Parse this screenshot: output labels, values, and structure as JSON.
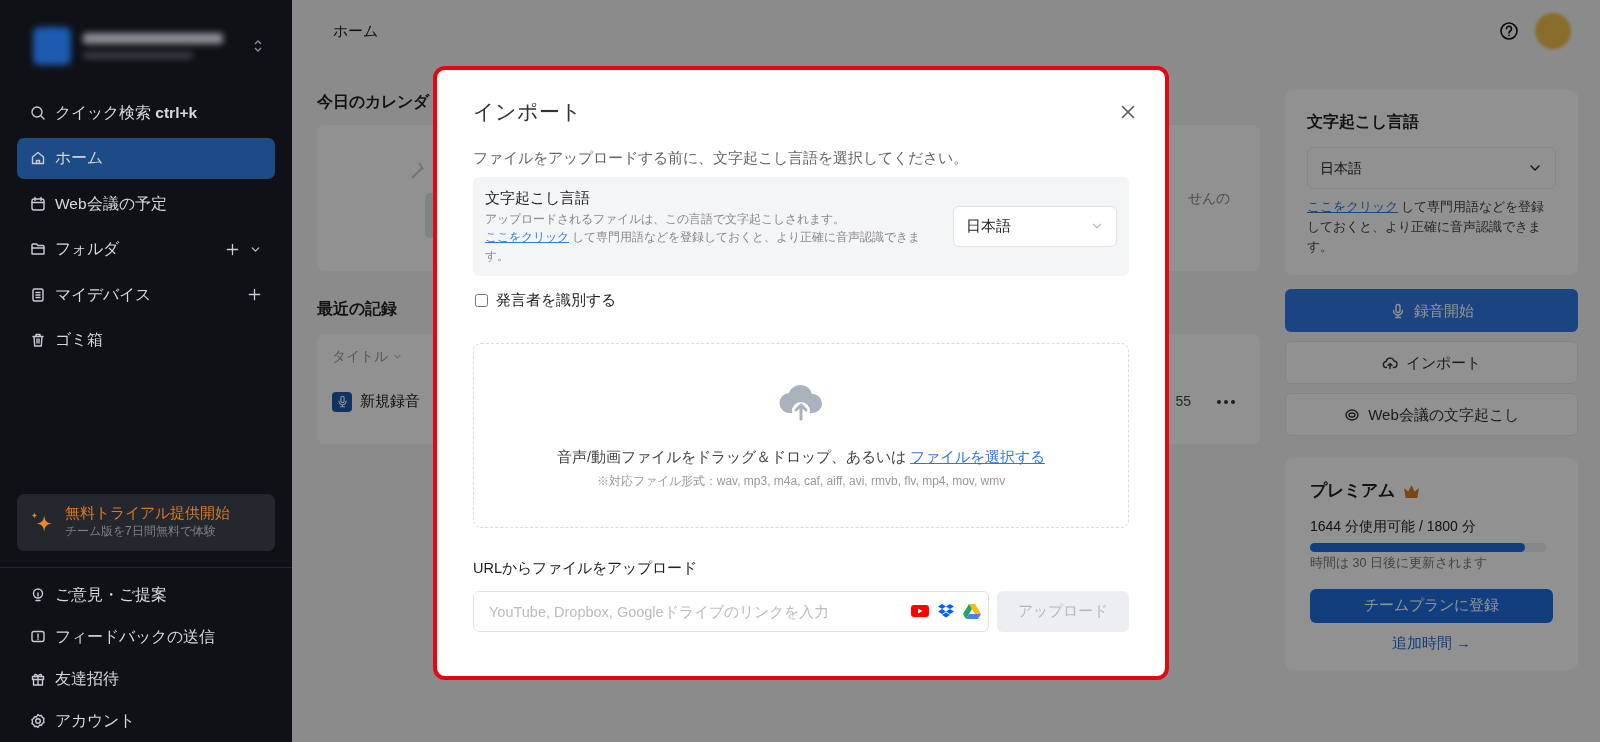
{
  "sidebar": {
    "items": [
      {
        "label": "クイック検索 **ctrl+k**",
        "selected": false
      },
      {
        "label": "ホーム",
        "selected": true
      },
      {
        "label": "Web会議の予定",
        "selected": false
      },
      {
        "label": "フォルダ",
        "selected": false,
        "add": true,
        "expand": true
      },
      {
        "label": "マイデバイス",
        "selected": false,
        "add": true
      },
      {
        "label": "ゴミ箱",
        "selected": false
      }
    ],
    "promo": {
      "title": "無料トライアル提供開始",
      "subtitle": "チーム版を7日間無料で体験"
    },
    "footer_items": [
      {
        "label": "ご意見・ご提案"
      },
      {
        "label": "フィードバックの送信"
      },
      {
        "label": "友達招待"
      },
      {
        "label": "アカウント"
      }
    ]
  },
  "header": {
    "title": "ホーム"
  },
  "calendar": {
    "title": "今日のカレンダ",
    "note": "せんの"
  },
  "recent": {
    "title": "最近の記録",
    "column": "タイトル",
    "rows": [
      {
        "title": "新規録音",
        "time": "55"
      }
    ]
  },
  "right_panel": {
    "language_title": "文字起こし言語",
    "language_value": "日本語",
    "link": "ここをクリック",
    "note": "して専門用語などを登録しておくと、より正確に音声認識できます。",
    "buttons": [
      {
        "label": "録音開始",
        "kind": "primary"
      },
      {
        "label": "インポート",
        "kind": "outline"
      },
      {
        "label": "Web会議の文字起こし",
        "kind": "outline"
      }
    ],
    "premium": {
      "title": "プレミアム",
      "usage": "1644 分使用可能 / 1800 分",
      "level": 0.91,
      "renew": "時間は 30 日後に更新されます",
      "upgrade": "チームプランに登録",
      "more": "追加時間 →"
    }
  },
  "modal": {
    "title": "インポート",
    "intro": "ファイルをアップロードする前に、文字起こし言語を選択してください。",
    "language": {
      "label": "文字起こし言語",
      "description": "アップロードされるファイルは、この言語で文字起こしされます。",
      "link": "ここをクリック",
      "description_end": "して専門用語などを登録しておくと、より正確に音声認識できます。",
      "value": "日本語"
    },
    "speaker": {
      "label": "発言者を識別する",
      "checked": false
    },
    "dropzone": {
      "text": "音声/動画ファイルをドラッグ＆ドロップ、あるいは",
      "link": "ファイルを選択する",
      "formats": "※対応ファイル形式：wav, mp3, m4a, caf, aiff, avi, rmvb, flv, mp4, mov, wmv"
    },
    "url": {
      "label": "URLからファイルをアップロード",
      "placeholder": "YouTube, Dropbox, Googleドライブのリンクを入力",
      "button": "アップロード",
      "disabled": true
    }
  }
}
